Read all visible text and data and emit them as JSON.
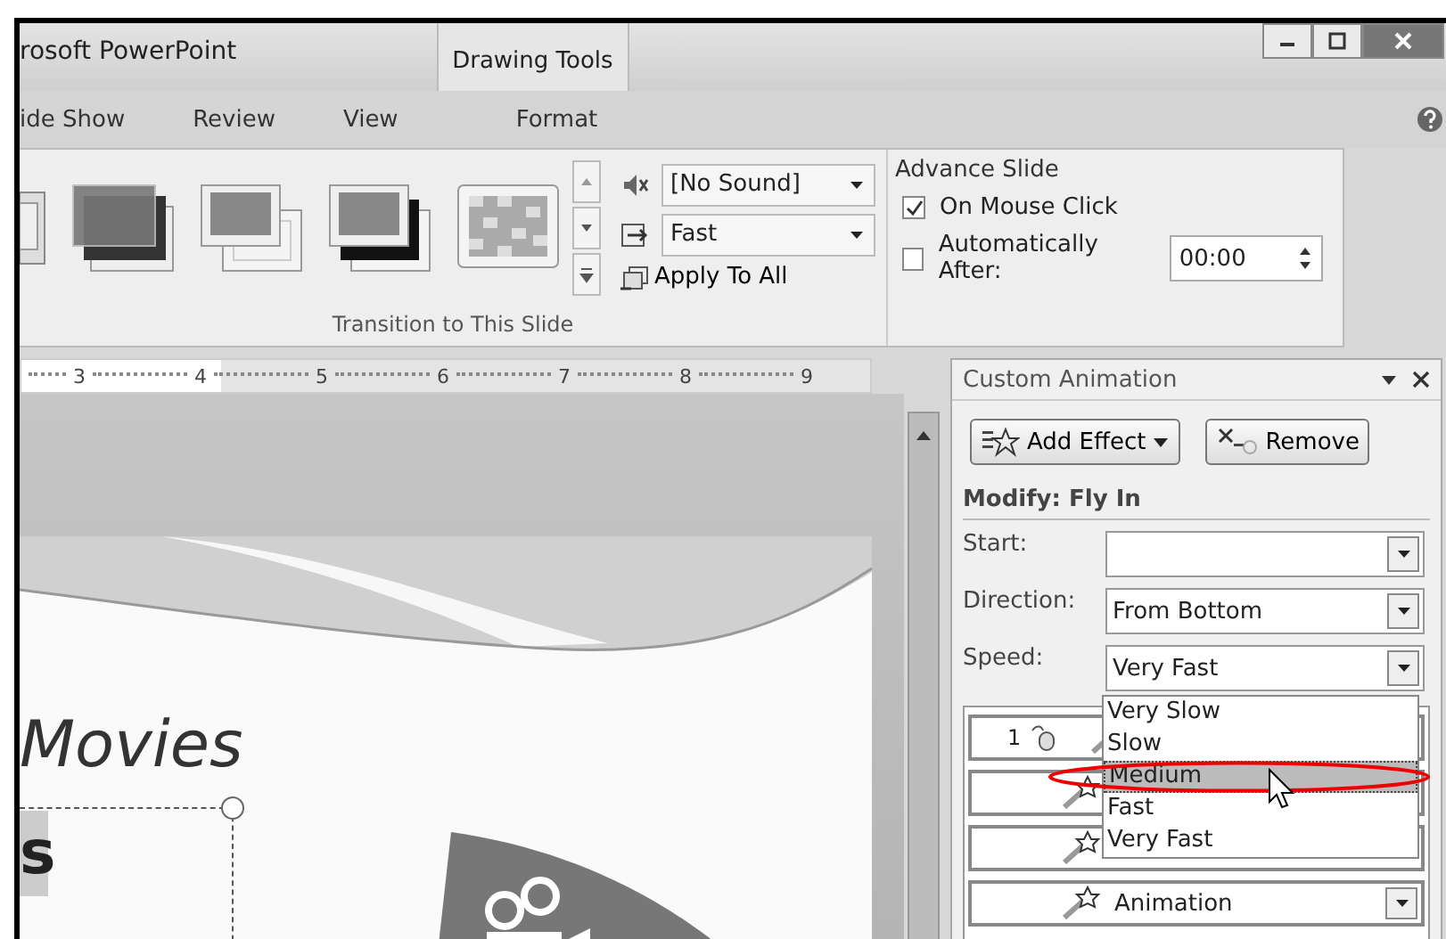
{
  "window": {
    "title": "rosoft PowerPoint",
    "contextual_group": "Drawing Tools"
  },
  "ribbon_tabs": [
    {
      "label": "ide Show",
      "selected": false
    },
    {
      "label": "Review",
      "selected": false
    },
    {
      "label": "View",
      "selected": false
    },
    {
      "label": "Format",
      "selected": false
    }
  ],
  "transition_gallery": [
    {
      "kind": "partial"
    },
    {
      "kind": "fade"
    },
    {
      "kind": "push"
    },
    {
      "kind": "shadow"
    },
    {
      "kind": "checker"
    }
  ],
  "transition_sound": {
    "value": "[No Sound]"
  },
  "transition_speed": {
    "value": "Fast"
  },
  "apply_to_all": "Apply To All",
  "group_label": "Transition to This Slide",
  "advance_slide": {
    "title": "Advance Slide",
    "options": [
      {
        "label": "On Mouse Click",
        "checked": true
      },
      {
        "label": "Automatically After:",
        "checked": false,
        "value": "00:00"
      }
    ]
  },
  "ruler": {
    "labels": [
      "3",
      "4",
      "5",
      "6",
      "7",
      "8",
      "9"
    ]
  },
  "slide": {
    "title": "Movies",
    "placeholder_text": "s"
  },
  "task_pane": {
    "title": "Custom Animation",
    "add_effect": "Add Effect",
    "remove": "Remove",
    "modify_title": "Modify: Fly In",
    "fields": [
      {
        "label": "Start:"
      },
      {
        "label": "Direction:",
        "value": "From Bottom"
      },
      {
        "label": "Speed:",
        "value": "Very Fast"
      }
    ],
    "animation_list": [
      {
        "kind": "trigger",
        "number": "1"
      },
      {
        "kind": "effect"
      },
      {
        "kind": "effect"
      },
      {
        "kind": "menu",
        "label": "Animation"
      }
    ],
    "speed_dropdown": [
      {
        "label": "Very Slow",
        "selected": false
      },
      {
        "label": "Slow",
        "selected": false
      },
      {
        "label": "Medium",
        "selected": true
      },
      {
        "label": "Fast",
        "selected": false
      },
      {
        "label": "Very Fast",
        "selected": false
      }
    ]
  }
}
